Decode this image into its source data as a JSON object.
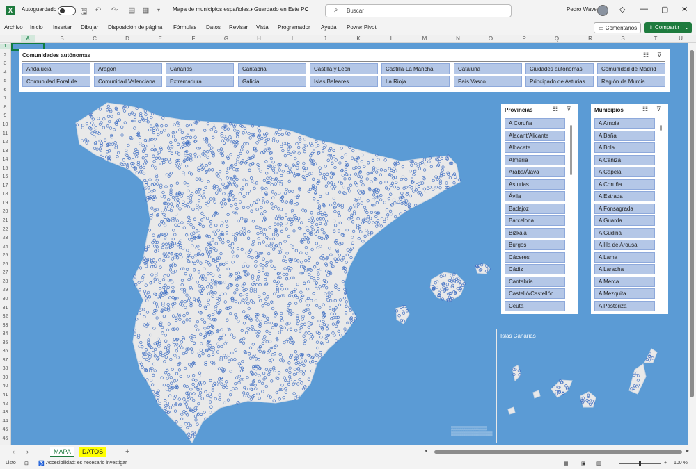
{
  "titlebar": {
    "autosave_label": "Autoguardado",
    "document_title": "Mapa de municipios españoles...",
    "save_status": "• Guardado en Este PC",
    "search_placeholder": "Buscar",
    "user_name": "Pedro Wave"
  },
  "menu": [
    "Archivo",
    "Inicio",
    "Insertar",
    "Dibujar",
    "Disposición de página",
    "Fórmulas",
    "Datos",
    "Revisar",
    "Vista",
    "Programador",
    "Ayuda",
    "Power Pivot"
  ],
  "comments_button": "Comentarios",
  "share_button": "Compartir",
  "columns": [
    "A",
    "B",
    "C",
    "D",
    "E",
    "F",
    "G",
    "H",
    "I",
    "J",
    "K",
    "L",
    "M",
    "N",
    "O",
    "P",
    "Q",
    "R",
    "S",
    "T",
    "U"
  ],
  "rows": [
    "1",
    "2",
    "3",
    "4",
    "5",
    "6",
    "7",
    "8",
    "9",
    "10",
    "11",
    "12",
    "13",
    "14",
    "15",
    "16",
    "17",
    "18",
    "19",
    "20",
    "21",
    "22",
    "23",
    "24",
    "25",
    "26",
    "27",
    "28",
    "29",
    "30",
    "31",
    "32",
    "33",
    "34",
    "35",
    "36",
    "37",
    "38",
    "39",
    "40",
    "41",
    "42",
    "43",
    "44",
    "45",
    "46"
  ],
  "slicer_comunidades": {
    "title": "Comunidades autónomas",
    "items": [
      "Andalucía",
      "Aragón",
      "Canarias",
      "Cantabria",
      "Castilla y León",
      "Castilla-La Mancha",
      "Cataluña",
      "Ciudades autónomas",
      "Comunidad de Madrid",
      "Comunidad Foral de ...",
      "Comunidad Valenciana",
      "Extremadura",
      "Galicia",
      "Islas Baleares",
      "La Rioja",
      "País Vasco",
      "Principado de Asturias",
      "Región de Murcia"
    ]
  },
  "slicer_provincias": {
    "title": "Provincias",
    "items": [
      "A Coruña",
      "Alacant/Alicante",
      "Albacete",
      "Almería",
      "Araba/Álava",
      "Asturias",
      "Ávila",
      "Badajoz",
      "Barcelona",
      "Bizkaia",
      "Burgos",
      "Cáceres",
      "Cádiz",
      "Cantabria",
      "Castelló/Castellón",
      "Ceuta"
    ]
  },
  "slicer_municipios": {
    "title": "Municipios",
    "items": [
      "A Arnoia",
      "A Baña",
      "A Bola",
      "A Cañiza",
      "A Capela",
      "A Coruña",
      "A Estrada",
      "A Fonsagrada",
      "A Guarda",
      "A Gudiña",
      "A Illa de Arousa",
      "A Lama",
      "A Laracha",
      "A Merca",
      "A Mezquita",
      "A Pastoriza"
    ]
  },
  "map": {
    "canarias_label": "Islas Canarias",
    "sea_color": "#5b9bd5",
    "land_color": "#e9e9e9",
    "point_color": "#4472c4"
  },
  "sheet_tabs": [
    "MAPA",
    "DATOS"
  ],
  "status": {
    "ready": "Listo",
    "accessibility": "Accesibilidad: es necesario investigar",
    "zoom": "100 %"
  }
}
